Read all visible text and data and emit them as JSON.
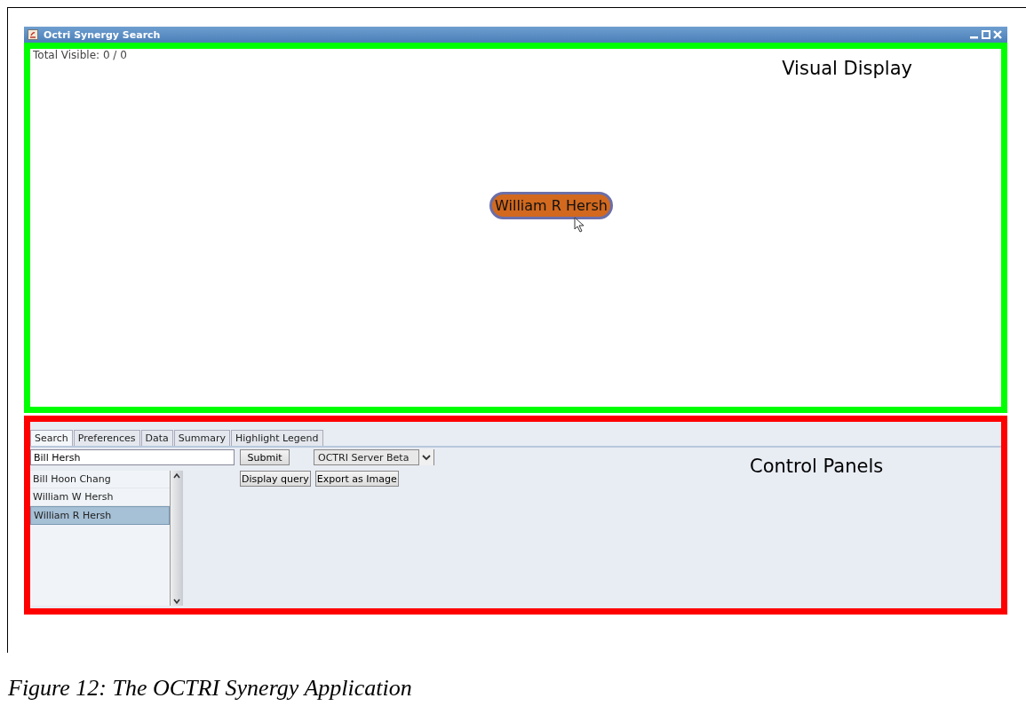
{
  "window": {
    "title": "Octri Synergy Search"
  },
  "visual_display": {
    "annotation": "Visual Display",
    "total_visible": "Total Visible: 0 / 0",
    "node": {
      "label": "William R Hersh"
    }
  },
  "control_panels": {
    "annotation": "Control Panels",
    "tabs": [
      {
        "label": "Search",
        "selected": true
      },
      {
        "label": "Preferences",
        "selected": false
      },
      {
        "label": "Data",
        "selected": false
      },
      {
        "label": "Summary",
        "selected": false
      },
      {
        "label": "Highlight Legend",
        "selected": false
      }
    ],
    "search_field": {
      "value": "Bill Hersh"
    },
    "submit": "Submit",
    "server": {
      "value": "OCTRI Server Beta"
    },
    "buttons": [
      "Display query",
      "Export as Image"
    ],
    "results": [
      {
        "label": "Bill Hoon Chang",
        "selected": false
      },
      {
        "label": "William W Hersh",
        "selected": false
      },
      {
        "label": "William R Hersh",
        "selected": true
      }
    ]
  },
  "caption": "Figure 12: The OCTRI Synergy Application"
}
